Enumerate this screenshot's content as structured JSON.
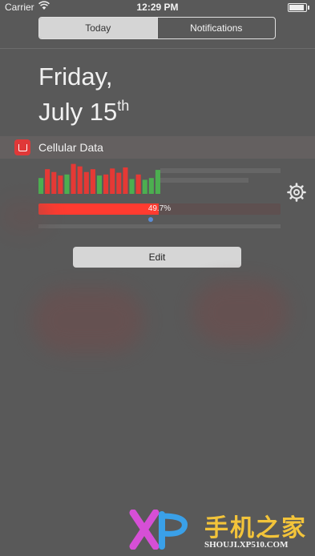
{
  "status_bar": {
    "carrier": "Carrier",
    "time": "12:29 PM"
  },
  "segmented_control": {
    "tabs": [
      {
        "label": "Today",
        "selected": true
      },
      {
        "label": "Notifications",
        "selected": false
      }
    ]
  },
  "date": {
    "line1": "Friday,",
    "line2_prefix": "July 15",
    "line2_suffix": "th"
  },
  "widget": {
    "title": "Cellular Data",
    "icon": "cellular-data-app-icon",
    "usage_bars": [
      {
        "value": 0.45,
        "color": "#4caf50"
      },
      {
        "value": 0.7,
        "color": "#e53935"
      },
      {
        "value": 0.62,
        "color": "#e53935"
      },
      {
        "value": 0.52,
        "color": "#e53935"
      },
      {
        "value": 0.55,
        "color": "#4caf50"
      },
      {
        "value": 0.85,
        "color": "#e53935"
      },
      {
        "value": 0.78,
        "color": "#e53935"
      },
      {
        "value": 0.62,
        "color": "#e53935"
      },
      {
        "value": 0.7,
        "color": "#e53935"
      },
      {
        "value": 0.52,
        "color": "#4caf50"
      },
      {
        "value": 0.55,
        "color": "#e53935"
      },
      {
        "value": 0.72,
        "color": "#e53935"
      },
      {
        "value": 0.6,
        "color": "#e53935"
      },
      {
        "value": 0.75,
        "color": "#e53935"
      },
      {
        "value": 0.42,
        "color": "#4caf50"
      },
      {
        "value": 0.55,
        "color": "#e53935"
      },
      {
        "value": 0.4,
        "color": "#4caf50"
      },
      {
        "value": 0.45,
        "color": "#4caf50"
      },
      {
        "value": 0.68,
        "color": "#4caf50"
      }
    ],
    "progress_percent": 49.7,
    "progress_label": "49.7%",
    "settings_icon": "gear-icon"
  },
  "edit_button": {
    "label": "Edit"
  },
  "watermark": {
    "cn_text": "手机之家",
    "url": "SHOUJI.XP510.COM"
  },
  "colors": {
    "background": "#595959",
    "accent_red": "#ff3b30",
    "bar_red": "#e53935",
    "bar_green": "#4caf50"
  }
}
